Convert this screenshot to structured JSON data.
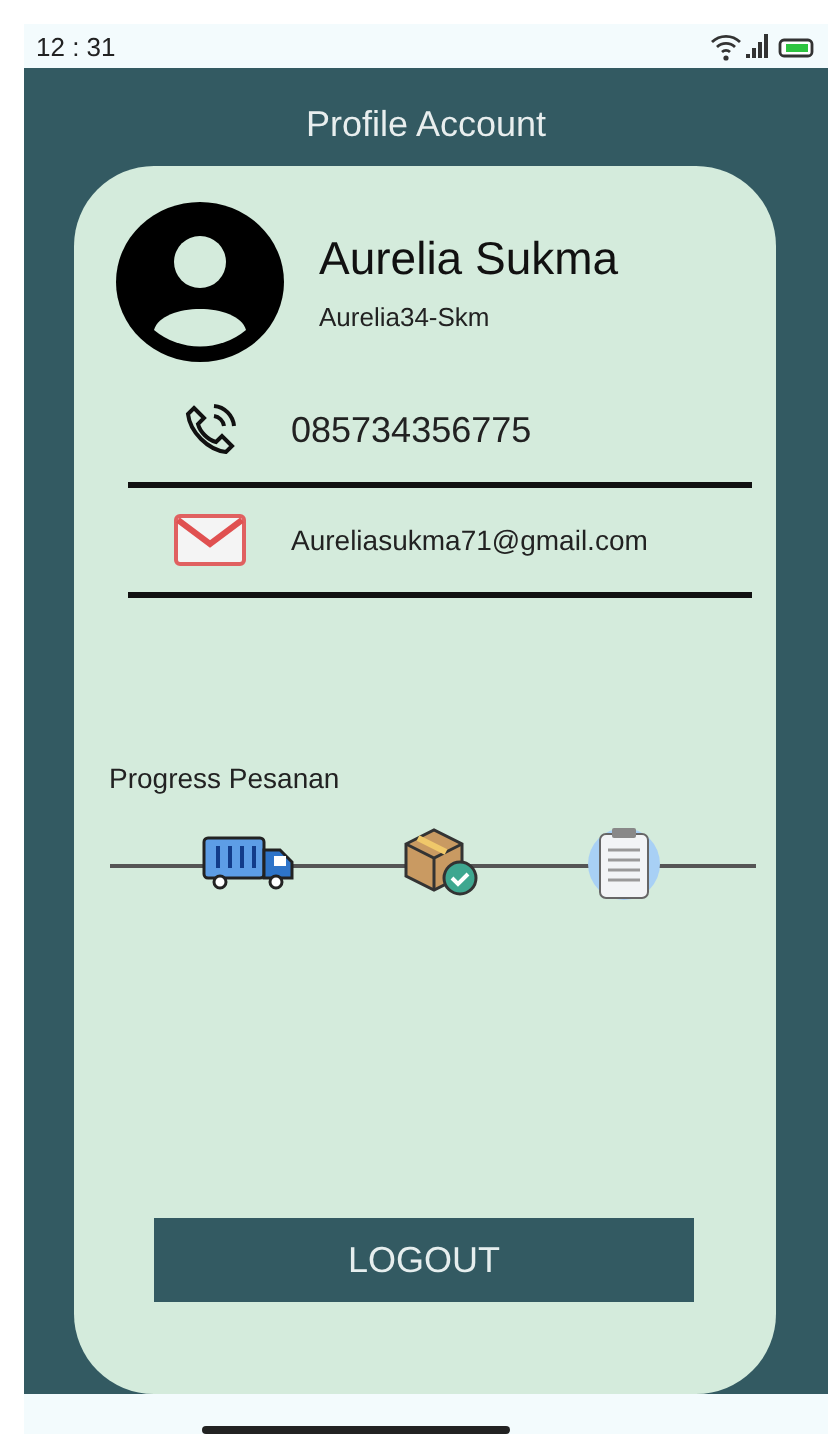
{
  "status_bar": {
    "time": "12 : 31"
  },
  "header": {
    "title": "Profile Account"
  },
  "profile": {
    "name": "Aurelia Sukma",
    "username": "Aurelia34-Skm"
  },
  "contacts": [
    {
      "kind": "phone",
      "value": "085734356775"
    },
    {
      "kind": "email",
      "value": "Aureliasukma71@gmail.com"
    }
  ],
  "progress": {
    "title": "Progress Pesanan",
    "steps": [
      {
        "kind": "truck"
      },
      {
        "kind": "box"
      },
      {
        "kind": "clipboard"
      }
    ]
  },
  "logout_button": "LOGOUT"
}
